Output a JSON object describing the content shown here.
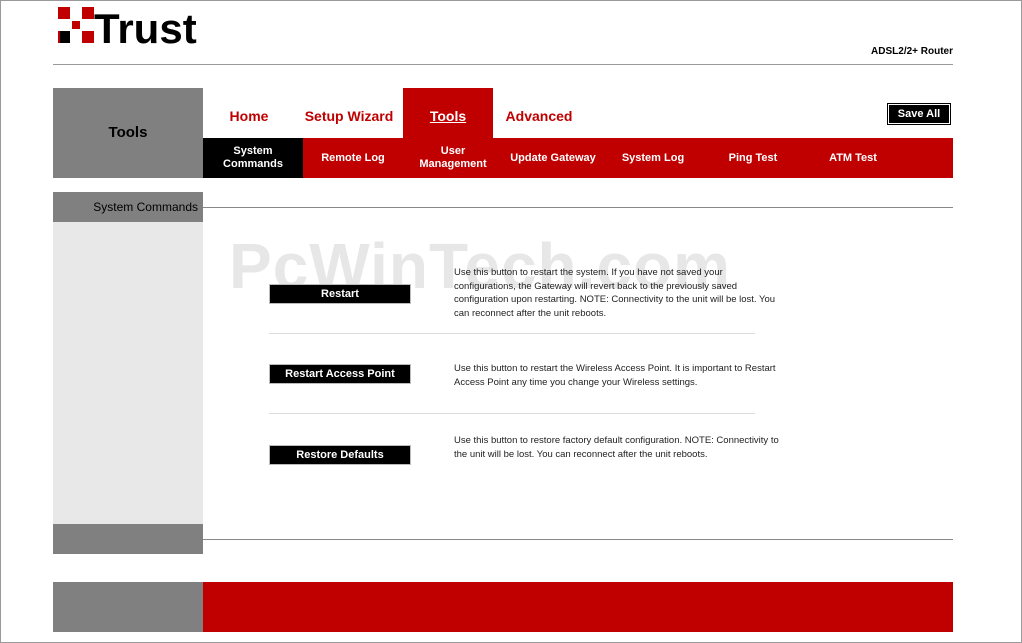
{
  "brand": {
    "logo_text": "Trust",
    "product": "ADSL2/2+ Router"
  },
  "header": {
    "section_title": "Tools",
    "save_all_label": "Save All"
  },
  "nav": {
    "main_tabs": [
      {
        "label": "Home"
      },
      {
        "label": "Setup Wizard"
      },
      {
        "label": "Tools",
        "active": true
      },
      {
        "label": "Advanced"
      }
    ],
    "sub_tabs": [
      {
        "label": "System Commands",
        "active": true
      },
      {
        "label": "Remote Log"
      },
      {
        "label": "User Management"
      },
      {
        "label": "Update Gateway"
      },
      {
        "label": "System Log"
      },
      {
        "label": "Ping Test"
      },
      {
        "label": "ATM Test"
      }
    ]
  },
  "sidebar": {
    "label": "System Commands"
  },
  "watermark": "PcWinTech.com",
  "actions": [
    {
      "button": "Restart",
      "description": "Use this button to restart the system. If you have not saved your configurations, the Gateway will revert back to the previously saved configuration upon restarting. NOTE: Connectivity to the unit will be lost. You can reconnect after the unit reboots."
    },
    {
      "button": "Restart Access Point",
      "description": "Use this button to restart the Wireless Access Point. It is important to Restart Access Point any time you change your Wireless settings."
    },
    {
      "button": "Restore Defaults",
      "description": "Use this button to restore factory default configuration. NOTE: Connectivity to the unit will be lost. You can reconnect after the unit reboots."
    }
  ],
  "colors": {
    "brand_red": "#c00000",
    "panel_gray": "#808080",
    "light_gray": "#e8e8e8"
  }
}
